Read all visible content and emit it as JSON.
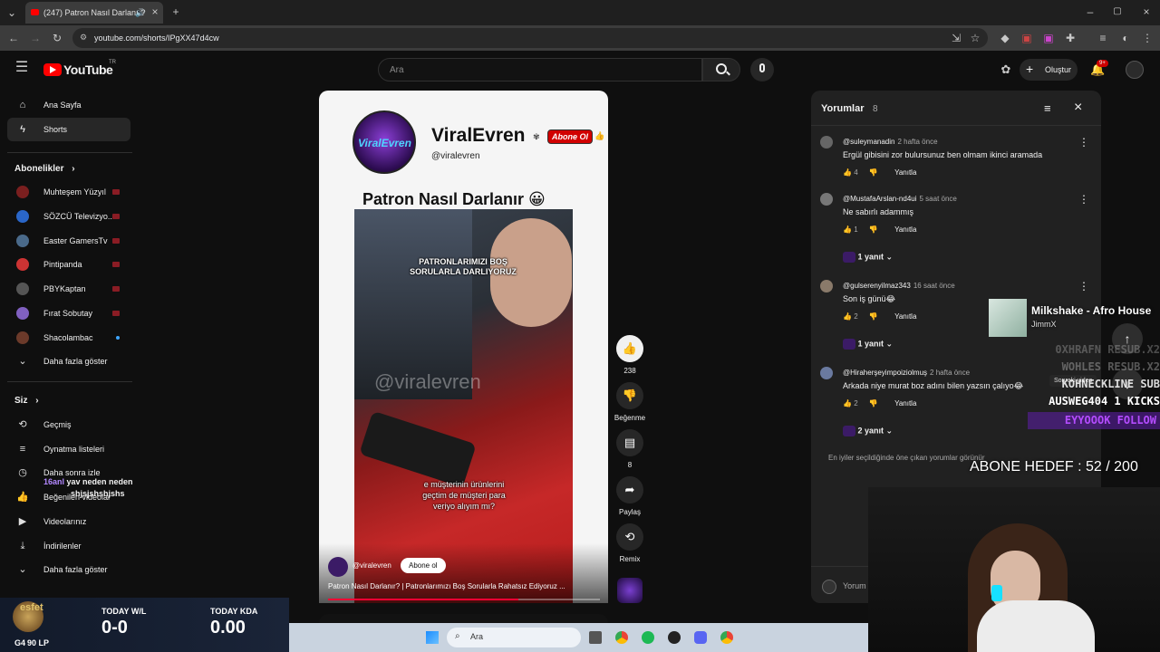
{
  "browser": {
    "tab_title": "(247) Patron Nasıl Darlanır?",
    "url": "youtube.com/shorts/IPgXX47d4cw"
  },
  "header": {
    "logo_text": "YouTube",
    "logo_region": "TR",
    "search_placeholder": "Ara",
    "create_label": "Oluştur",
    "notif_count": "9+"
  },
  "sidebar": {
    "main": [
      {
        "label": "Ana Sayfa",
        "icon": "home-icon"
      },
      {
        "label": "Shorts",
        "icon": "shorts-icon"
      }
    ],
    "subs_title": "Abonelikler",
    "subs": [
      {
        "label": "Muhteşem Yüzyıl",
        "color": "#7a1f1f"
      },
      {
        "label": "SÖZCÜ Televizyo...",
        "color": "#2a66c8"
      },
      {
        "label": "Easter GamersTv",
        "color": "#4a6a8a"
      },
      {
        "label": "Pintipanda",
        "color": "#c33"
      },
      {
        "label": "PBYKaptan",
        "color": "#555"
      },
      {
        "label": "Fırat Sobutay",
        "color": "#8060c0"
      },
      {
        "label": "Shacolambac",
        "color": "#6b3a2a"
      }
    ],
    "more_subs": "Daha fazla göster",
    "you_title": "Siz",
    "you": [
      {
        "label": "Geçmiş",
        "icon": "history-icon"
      },
      {
        "label": "Oynatma listeleri",
        "icon": "playlist-icon"
      },
      {
        "label": "Daha sonra izle",
        "icon": "clock-icon"
      },
      {
        "label": "Beğenilen videolar",
        "icon": "like-icon"
      },
      {
        "label": "Videolarınız",
        "icon": "video-icon"
      },
      {
        "label": "İndirilenler",
        "icon": "download-icon"
      }
    ],
    "more_you": "Daha fazla göster"
  },
  "video": {
    "channel_name": "ViralEvren",
    "channel_handle": "@viralevren",
    "subscribe_badge": "Abone Ol",
    "title_text": "Patron Nasıl Darlanır 😀",
    "caption_top": "PATRONLARIMIZI BOŞ SORULARLA DARLIYORUZ",
    "caption_bottom": "e müşterinin ürünlerini geçtim de müşteri para veriyo alıyım mı?",
    "watermark": "@viralevren",
    "footer_handle": "@viralevren",
    "footer_sub_btn": "Abone ol",
    "footer_title": "Patron Nasıl Darlanır? | Patronlarımızı Boş Sorularla Rahatsız Ediyoruz ...",
    "progress": 0.7
  },
  "actions": {
    "likes": "238",
    "dislike": "Beğenme",
    "comments": "8",
    "share": "Paylaş",
    "remix": "Remix"
  },
  "comments": {
    "title": "Yorumlar",
    "count": "8",
    "reply_label": "Yanıtla",
    "items": [
      {
        "user": "@suleymanadin",
        "time": "2 hafta önce",
        "text": "Ergül gibisini zor bulursunuz ben olmam ikinci aramada",
        "likes": "4",
        "replies": ""
      },
      {
        "user": "@MustafaArslan-nd4ui",
        "time": "5 saat önce",
        "text": "Ne sabırlı adammış",
        "likes": "1",
        "replies": "1 yanıt"
      },
      {
        "user": "@gulserenyilmaz343",
        "time": "16 saat önce",
        "text": "Son iş günü😂",
        "likes": "2",
        "replies": "1 yanıt"
      },
      {
        "user": "@Hiraherşeyimpoiziolmuş",
        "time": "2 hafta önce",
        "text": "Arkada niye murat boz adını bilen yazsın çalıyo😂",
        "likes": "2",
        "replies": "2 yanıt"
      }
    ],
    "footer_note": "En iyiler seçildiğinde öne çıkan yorumlar görünür",
    "input_placeholder": "Yorum ekle..."
  },
  "next_video_tooltip": "Sonraki video",
  "stream_overlay": {
    "song_title": "Milkshake - Afro House",
    "song_artist": "JimmX",
    "subs_line1": "0XHRAFN  RESUB.X2",
    "subs_line2": "WOHLES  RESUB.X2",
    "subs_line3": "KOHNECKLINE SUB",
    "subs_line4": "AUSWEG404  1 KICKS",
    "follow_line": "EYYOOOK  FOLLOW",
    "goal": "ABONE HEDEF : 52 / 200",
    "chat_line1_user": "16anl",
    "chat_line1_text": "yav neden neden",
    "chat_line2_text": "shjsjshshjshs",
    "player_name": "esfet",
    "rank": "G4",
    "lp": "90 LP",
    "wl_label": "TODAY W/L",
    "wl_value": "0-0",
    "kda_label": "TODAY KDA",
    "kda_value": "0.00"
  },
  "taskbar": {
    "search_placeholder": "Ara"
  }
}
